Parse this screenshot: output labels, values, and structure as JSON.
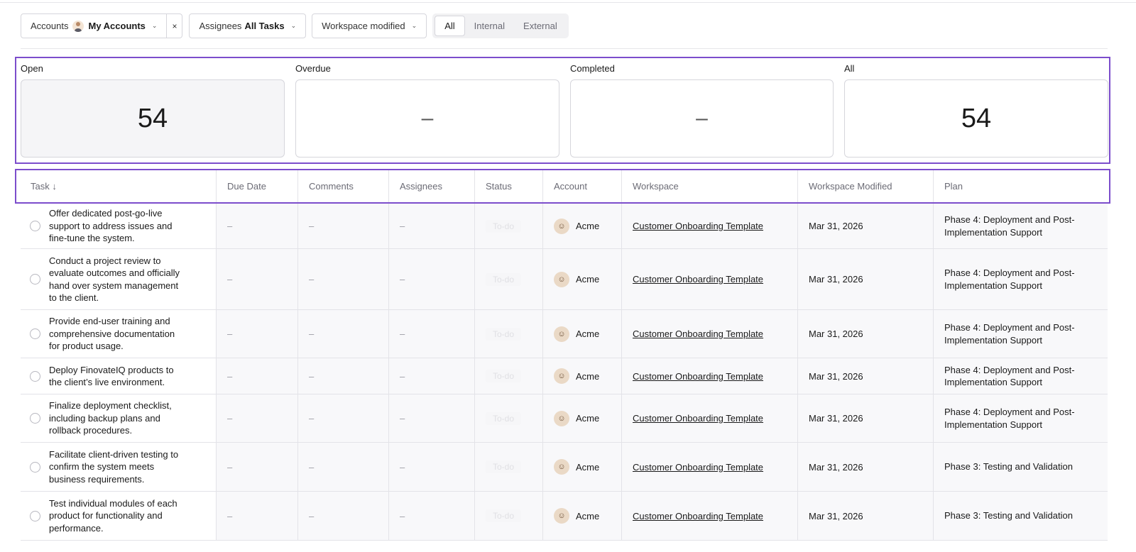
{
  "filters": {
    "accounts_label": "Accounts",
    "accounts_value": "My Accounts",
    "clear_symbol": "×",
    "assignees_label": "Assignees",
    "assignees_value": "All Tasks",
    "workspace_modified_label": "Workspace modified",
    "segments": [
      "All",
      "Internal",
      "External"
    ],
    "active_segment": "All"
  },
  "stats": [
    {
      "label": "Open",
      "value": "54"
    },
    {
      "label": "Overdue",
      "value": "–"
    },
    {
      "label": "Completed",
      "value": "–"
    },
    {
      "label": "All",
      "value": "54"
    }
  ],
  "table": {
    "columns": [
      "Task ↓",
      "Due Date",
      "Comments",
      "Assignees",
      "Status",
      "Account",
      "Workspace",
      "Workspace Modified",
      "Plan"
    ],
    "rows": [
      {
        "task": "Offer dedicated post-go-live support to address issues and fine-tune the system.",
        "due_date": "–",
        "comments": "–",
        "assignees": "–",
        "status": "To-do",
        "account": "Acme",
        "workspace": "Customer Onboarding Template",
        "modified": "Mar 31, 2026",
        "plan": "Phase 4: Deployment and Post-Implementation Support"
      },
      {
        "task": "Conduct a project review to evaluate outcomes and officially hand over system management to the client.",
        "due_date": "–",
        "comments": "–",
        "assignees": "–",
        "status": "To-do",
        "account": "Acme",
        "workspace": "Customer Onboarding Template",
        "modified": "Mar 31, 2026",
        "plan": "Phase 4: Deployment and Post-Implementation Support"
      },
      {
        "task": "Provide end-user training and comprehensive documentation for product usage.",
        "due_date": "–",
        "comments": "–",
        "assignees": "–",
        "status": "To-do",
        "account": "Acme",
        "workspace": "Customer Onboarding Template",
        "modified": "Mar 31, 2026",
        "plan": "Phase 4: Deployment and Post-Implementation Support"
      },
      {
        "task": "Deploy FinovateIQ products to the client’s live environment.",
        "due_date": "–",
        "comments": "–",
        "assignees": "–",
        "status": "To-do",
        "account": "Acme",
        "workspace": "Customer Onboarding Template",
        "modified": "Mar 31, 2026",
        "plan": "Phase 4: Deployment and Post-Implementation Support"
      },
      {
        "task": "Finalize deployment checklist, including backup plans and rollback procedures.",
        "due_date": "–",
        "comments": "–",
        "assignees": "–",
        "status": "To-do",
        "account": "Acme",
        "workspace": "Customer Onboarding Template",
        "modified": "Mar 31, 2026",
        "plan": "Phase 4: Deployment and Post-Implementation Support"
      },
      {
        "task": "Facilitate client-driven testing to confirm the system meets business requirements.",
        "due_date": "–",
        "comments": "–",
        "assignees": "–",
        "status": "To-do",
        "account": "Acme",
        "workspace": "Customer Onboarding Template",
        "modified": "Mar 31, 2026",
        "plan": "Phase 3: Testing and Validation"
      },
      {
        "task": "Test individual modules of each product for functionality and performance.",
        "due_date": "–",
        "comments": "–",
        "assignees": "–",
        "status": "To-do",
        "account": "Acme",
        "workspace": "Customer Onboarding Template",
        "modified": "Mar 31, 2026",
        "plan": "Phase 3: Testing and Validation"
      }
    ]
  },
  "colors": {
    "highlight_border": "#7c4dcc",
    "border": "#d6d6dc",
    "muted_text": "#6b6b75"
  },
  "icons": {
    "accounts_avatar": "user-avatar-icon",
    "chevron": "chevron-down-icon",
    "sort": "arrow-down-icon",
    "task_checkbox": "circle-checkbox-icon",
    "account_logo": "acme-logo-icon"
  }
}
